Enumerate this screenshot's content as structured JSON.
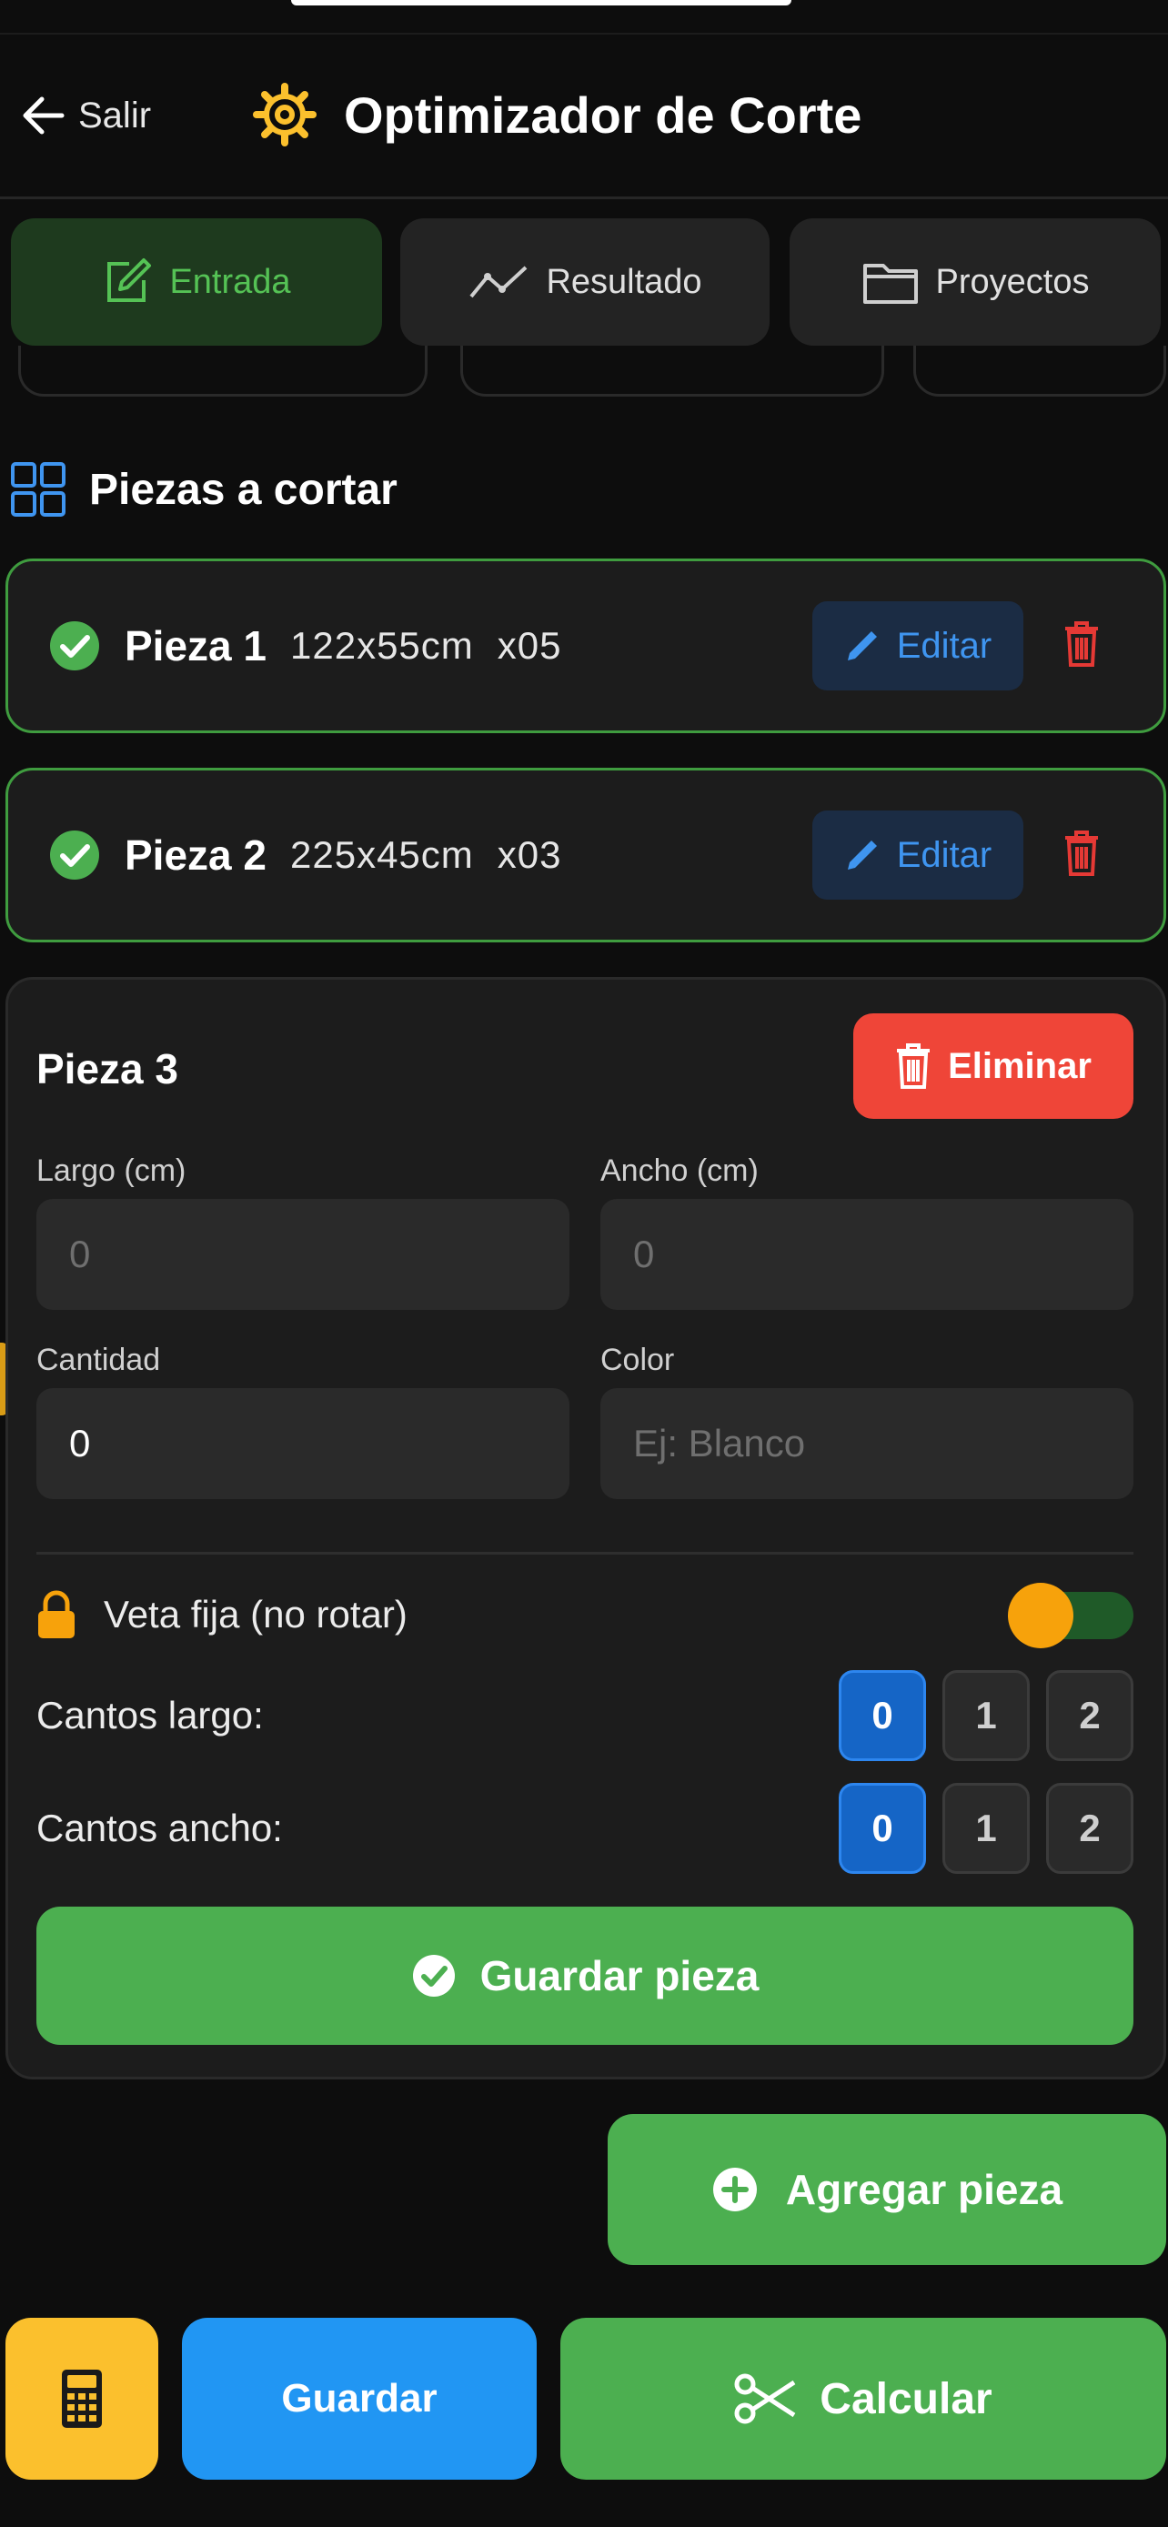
{
  "header": {
    "back_label": "Salir",
    "title": "Optimizador de Corte",
    "accent": "#fbc02d"
  },
  "tabs": [
    {
      "label": "Entrada",
      "icon": "edit-square-icon",
      "active": true
    },
    {
      "label": "Resultado",
      "icon": "line-chart-icon",
      "active": false
    },
    {
      "label": "Proyectos",
      "icon": "folder-icon",
      "active": false
    }
  ],
  "section": {
    "title": "Piezas a cortar",
    "icon": "grid-icon"
  },
  "pieces": [
    {
      "name": "Pieza 1",
      "dims": "122x55cm",
      "qty": "x05",
      "edit_label": "Editar"
    },
    {
      "name": "Pieza 2",
      "dims": "225x45cm",
      "qty": "x03",
      "edit_label": "Editar"
    }
  ],
  "editor": {
    "title": "Pieza 3",
    "delete_label": "Eliminar",
    "largo_label": "Largo (cm)",
    "largo_placeholder": "0",
    "ancho_label": "Ancho (cm)",
    "ancho_placeholder": "0",
    "cantidad_label": "Cantidad",
    "cantidad_value": "0",
    "color_label": "Color",
    "color_placeholder": "Ej: Blanco",
    "veta_label": "Veta fija (no rotar)",
    "veta_on": true,
    "cantos_largo_label": "Cantos largo:",
    "cantos_ancho_label": "Cantos ancho:",
    "cantos_options": [
      "0",
      "1",
      "2"
    ],
    "cantos_largo_selected": "0",
    "cantos_ancho_selected": "0",
    "save_label": "Guardar pieza"
  },
  "actions": {
    "add_label": "Agregar pieza",
    "guardar_label": "Guardar",
    "calcular_label": "Calcular"
  },
  "colors": {
    "green": "#4caf50",
    "blue": "#2196f3",
    "red": "#ef4538",
    "yellow": "#fbc02d",
    "orange": "#f7a20b"
  }
}
